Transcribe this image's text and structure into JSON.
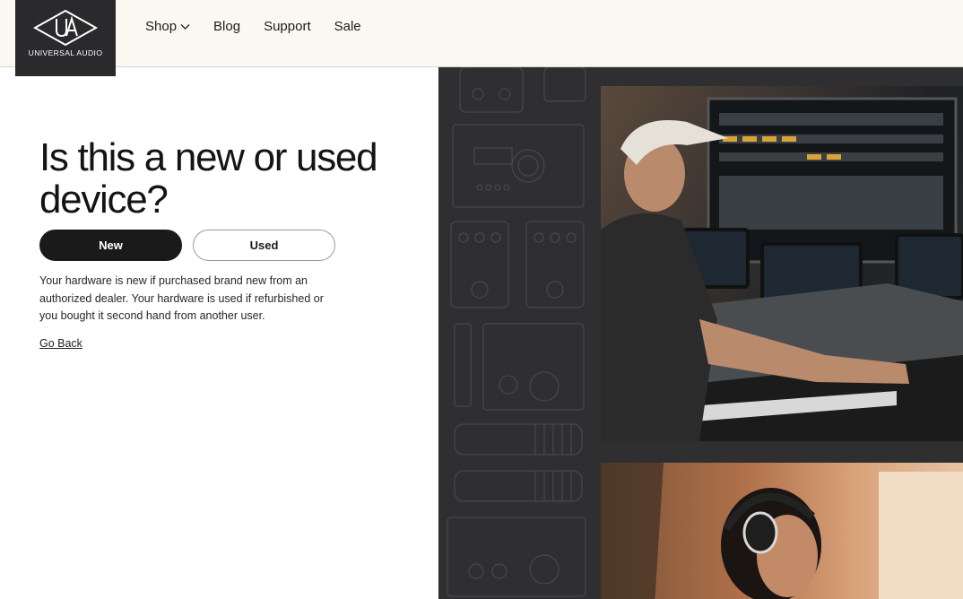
{
  "brand": {
    "name": "UNIVERSAL AUDIO"
  },
  "nav": {
    "items": [
      {
        "label": "Shop",
        "has_dropdown": true
      },
      {
        "label": "Blog"
      },
      {
        "label": "Support"
      },
      {
        "label": "Sale"
      }
    ]
  },
  "main": {
    "title": "Is this a new or used device?",
    "buttons": {
      "new_label": "New",
      "used_label": "Used"
    },
    "description": "Your hardware is new if purchased brand new from an authorized dealer. Your hardware is used if refurbished or you bought it second hand from another user.",
    "go_back_label": "Go Back"
  },
  "colors": {
    "header_bg": "#fbf8f2",
    "logo_bg": "#2a2a2c",
    "primary_btn": "#1a1a1a",
    "panel_bg": "#2f2f31"
  },
  "icons": {
    "logo": "ua-diamond-logo",
    "dropdown": "chevron-down-icon"
  }
}
